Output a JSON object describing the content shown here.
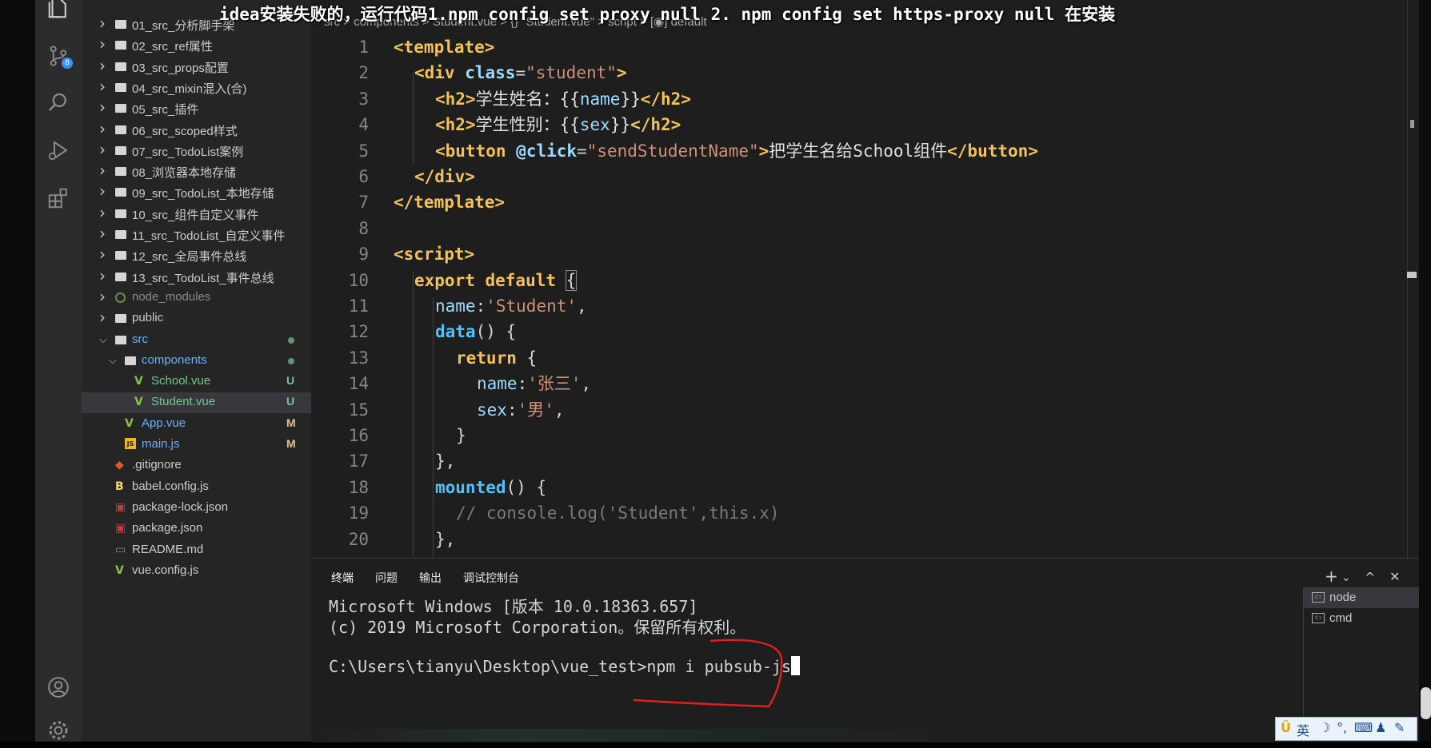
{
  "subtitle": "idea安装失败的，运行代码1.npm config set proxy null 2. npm config set https-proxy null  在安装",
  "activity_bar": {
    "icons": [
      "files-icon",
      "source-control-icon",
      "search-icon",
      "run-debug-icon",
      "extensions-icon",
      "account-icon",
      "settings-gear-icon"
    ],
    "scm_badge": "8"
  },
  "explorer": {
    "items": [
      {
        "label": "01_src_分析脚手架",
        "type": "folder",
        "indent": 0,
        "status": ""
      },
      {
        "label": "02_src_ref属性",
        "type": "folder",
        "indent": 0,
        "status": ""
      },
      {
        "label": "03_src_props配置",
        "type": "folder",
        "indent": 0,
        "status": ""
      },
      {
        "label": "04_src_mixin混入(合)",
        "type": "folder",
        "indent": 0,
        "status": ""
      },
      {
        "label": "05_src_插件",
        "type": "folder",
        "indent": 0,
        "status": ""
      },
      {
        "label": "06_src_scoped样式",
        "type": "folder",
        "indent": 0,
        "status": ""
      },
      {
        "label": "07_src_TodoList案例",
        "type": "folder",
        "indent": 0,
        "status": ""
      },
      {
        "label": "08_浏览器本地存储",
        "type": "folder",
        "indent": 0,
        "status": ""
      },
      {
        "label": "09_src_TodoList_本地存储",
        "type": "folder",
        "indent": 0,
        "status": ""
      },
      {
        "label": "10_src_组件自定义事件",
        "type": "folder",
        "indent": 0,
        "status": ""
      },
      {
        "label": "11_src_TodoList_自定义事件",
        "type": "folder",
        "indent": 0,
        "status": ""
      },
      {
        "label": "12_src_全局事件总线",
        "type": "folder",
        "indent": 0,
        "status": ""
      },
      {
        "label": "13_src_TodoList_事件总线",
        "type": "folder",
        "indent": 0,
        "status": ""
      },
      {
        "label": "node_modules",
        "type": "folder-dim",
        "indent": 0,
        "status": ""
      },
      {
        "label": "public",
        "type": "folder",
        "indent": 0,
        "status": ""
      },
      {
        "label": "src",
        "type": "folder-open",
        "indent": 0,
        "status": "dot"
      },
      {
        "label": "components",
        "type": "folder-open",
        "indent": 1,
        "status": "dot"
      },
      {
        "label": "School.vue",
        "type": "vue",
        "indent": 2,
        "status": "U"
      },
      {
        "label": "Student.vue",
        "type": "vue",
        "indent": 2,
        "status": "U",
        "selected": true
      },
      {
        "label": "App.vue",
        "type": "vue",
        "indent": 1,
        "status": "M"
      },
      {
        "label": "main.js",
        "type": "js",
        "indent": 1,
        "status": "M"
      },
      {
        "label": ".gitignore",
        "type": "git",
        "indent": 0,
        "status": ""
      },
      {
        "label": "babel.config.js",
        "type": "babel",
        "indent": 0,
        "status": ""
      },
      {
        "label": "package-lock.json",
        "type": "npm",
        "indent": 0,
        "status": ""
      },
      {
        "label": "package.json",
        "type": "npm",
        "indent": 0,
        "status": ""
      },
      {
        "label": "README.md",
        "type": "md",
        "indent": 0,
        "status": ""
      },
      {
        "label": "vue.config.js",
        "type": "vue",
        "indent": 0,
        "status": ""
      }
    ]
  },
  "editor": {
    "breadcrumb": "src > components > Student.vue > {} \"Student.vue\" > script > [◉] default",
    "lines": [
      {
        "n": "1",
        "indent": 0,
        "html": "<span class='tag'>&lt;template&gt;</span>"
      },
      {
        "n": "2",
        "indent": 1,
        "html": "<span class='tag'>&lt;div</span> <span class='attr'>class</span><span class='punct'>=</span><span class='str'>\"student\"</span><span class='tag'>&gt;</span>"
      },
      {
        "n": "3",
        "indent": 2,
        "html": "<span class='tag'>&lt;h2&gt;</span><span class='txt'>学生姓名：{{</span><span class='prop'>name</span><span class='txt'>}}</span><span class='tag'>&lt;/h2&gt;</span>"
      },
      {
        "n": "4",
        "indent": 2,
        "html": "<span class='tag'>&lt;h2&gt;</span><span class='txt'>学生性别：{{</span><span class='prop'>sex</span><span class='txt'>}}</span><span class='tag'>&lt;/h2&gt;</span>"
      },
      {
        "n": "5",
        "indent": 2,
        "html": "<span class='tag'>&lt;button</span> <span class='attr'>@click</span><span class='punct'>=</span><span class='str'>\"sendStudentName\"</span><span class='tag'>&gt;</span><span class='txt'>把学生名给School组件</span><span class='tag'>&lt;/button&gt;</span>"
      },
      {
        "n": "6",
        "indent": 1,
        "html": "<span class='tag'>&lt;/div&gt;</span>"
      },
      {
        "n": "7",
        "indent": 0,
        "html": "<span class='tag'>&lt;/template&gt;</span>"
      },
      {
        "n": "8",
        "indent": 0,
        "html": ""
      },
      {
        "n": "9",
        "indent": 0,
        "html": "<span class='tag'>&lt;script&gt;</span>"
      },
      {
        "n": "10",
        "indent": 1,
        "html": "<span class='kw'>export default</span> <span class='punct' style='outline:1px solid #888'>{</span>"
      },
      {
        "n": "11",
        "indent": 2,
        "html": "<span class='prop'>name</span><span class='punct'>:</span><span class='str'>'Student'</span><span class='punct'>,</span>"
      },
      {
        "n": "12",
        "indent": 2,
        "html": "<span class='fn'>data</span><span class='punct'>() {</span>"
      },
      {
        "n": "13",
        "indent": 3,
        "html": "<span class='kw'>return</span> <span class='punct'>{</span>"
      },
      {
        "n": "14",
        "indent": 4,
        "html": "<span class='prop'>name</span><span class='punct'>:</span><span class='str'>'张三'</span><span class='punct'>,</span>"
      },
      {
        "n": "15",
        "indent": 4,
        "html": "<span class='prop'>sex</span><span class='punct'>:</span><span class='str'>'男'</span><span class='punct'>,</span>"
      },
      {
        "n": "16",
        "indent": 3,
        "html": "<span class='punct'>}</span>"
      },
      {
        "n": "17",
        "indent": 2,
        "html": "<span class='punct'>},</span>"
      },
      {
        "n": "18",
        "indent": 2,
        "html": "<span class='fn'>mounted</span><span class='punct'>() {</span>"
      },
      {
        "n": "19",
        "indent": 3,
        "html": "<span class='cm'>// console.log('Student',this.x)</span>"
      },
      {
        "n": "20",
        "indent": 2,
        "html": "<span class='punct'>},</span>"
      }
    ]
  },
  "panel": {
    "tabs": [
      "终端",
      "问题",
      "输出",
      "调试控制台"
    ],
    "active_tab": "终端",
    "actions": [
      "+",
      "⌄",
      "^",
      "✕"
    ],
    "terminal_lines": [
      "Microsoft Windows [版本 10.0.18363.657]",
      "(c) 2019 Microsoft Corporation。保留所有权利。",
      "",
      "C:\\Users\\tianyu\\Desktop\\vue_test>npm i pubsub-js"
    ],
    "terminals": [
      {
        "label": "node",
        "selected": true
      },
      {
        "label": "cmd",
        "selected": false
      }
    ]
  },
  "ime": {
    "label": "英"
  },
  "colors": {
    "annotation": "#e02020",
    "accent": "#3794ff"
  }
}
